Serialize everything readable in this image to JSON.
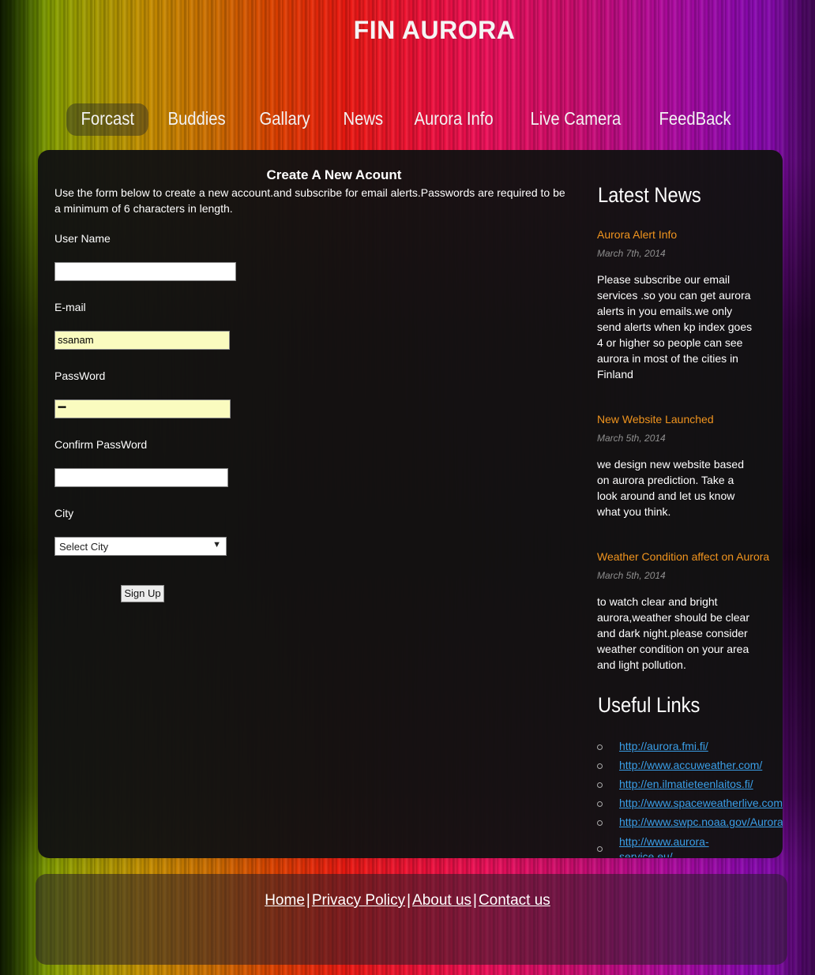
{
  "site": {
    "title": "FIN AURORA"
  },
  "nav": [
    {
      "label": "Forcast",
      "active": true
    },
    {
      "label": "Buddies"
    },
    {
      "label": "Gallary"
    },
    {
      "label": "News"
    },
    {
      "label": "Aurora Info"
    },
    {
      "label": "Live Camera"
    },
    {
      "label": "FeedBack"
    }
  ],
  "form": {
    "title": "Create A New Acount",
    "intro": "Use the form below to create a new account.and subscribe for email alerts.Passwords are required to be a minimum of 6 characters in length.",
    "username_label": "User Name",
    "username_value": "",
    "email_label": "E-mail",
    "email_value": "ssanam",
    "password_label": "PassWord",
    "password_value": "••••",
    "confirm_label": "Confirm PassWord",
    "confirm_value": "",
    "city_label": "City",
    "city_selected": "Select City",
    "submit_label": "Sign Up"
  },
  "sidebar": {
    "news_heading": "Latest News",
    "news": [
      {
        "title": "Aurora Alert Info",
        "date": "March 7th, 2014",
        "body": "Please subscribe our email services .so you can get aurora alerts in you emails.we only send alerts when kp index goes 4 or higher so people can see aurora in most of the cities in Finland"
      },
      {
        "title": "New Website Launched",
        "date": "March 5th, 2014",
        "body": "we design new website based on aurora prediction. Take a look around and let us know what you think."
      },
      {
        "title": "Weather Condition affect on Aurora",
        "date": "March 5th, 2014",
        "body": "to watch clear and bright aurora,weather should be clear and dark night.please consider weather condition on your area and light pollution."
      }
    ],
    "links_heading": "Useful Links",
    "links": [
      "http://aurora.fmi.fi/",
      "http://www.accuweather.com/",
      "http://en.ilmatieteenlaitos.fi/",
      "http://www.spaceweatherlive.com",
      "http://www.swpc.noaa.gov/Aurora",
      "http://www.aurora-service.eu/"
    ]
  },
  "footer": {
    "links": [
      "Home",
      "Privacy Policy",
      "About us",
      "Contact us"
    ],
    "separator": "|"
  }
}
